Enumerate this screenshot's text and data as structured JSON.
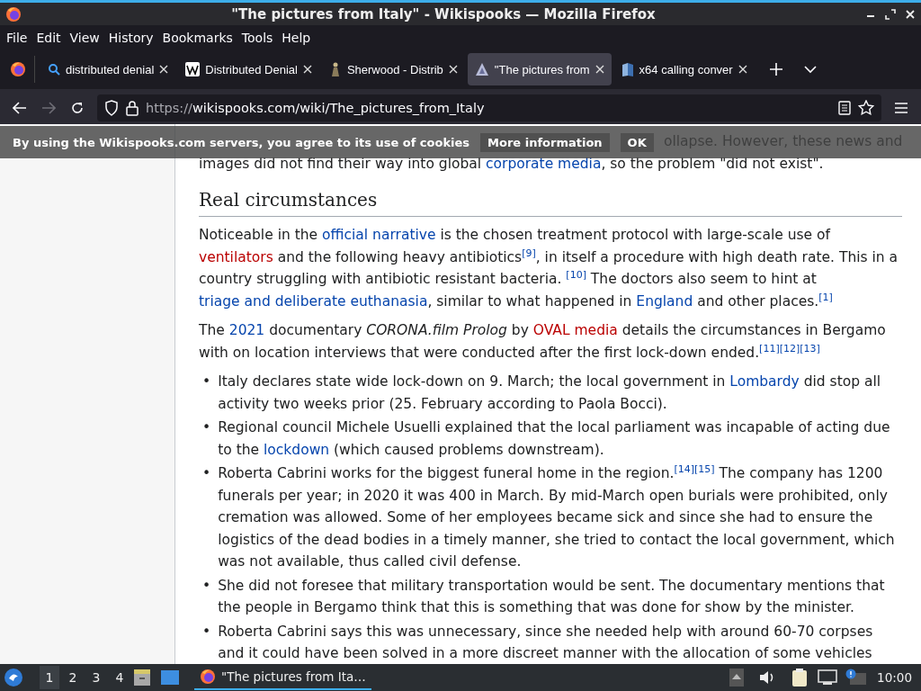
{
  "window": {
    "title": "\"The pictures from Italy\" - Wikispooks — Mozilla Firefox"
  },
  "menu": [
    "File",
    "Edit",
    "View",
    "History",
    "Bookmarks",
    "Tools",
    "Help"
  ],
  "tabs": [
    {
      "label": "distributed denial",
      "selected": false
    },
    {
      "label": "Distributed Denial",
      "selected": false
    },
    {
      "label": "Sherwood - Distrib",
      "selected": false
    },
    {
      "label": "\"The pictures from",
      "selected": true
    },
    {
      "label": "x64 calling conver",
      "selected": false
    }
  ],
  "url": {
    "scheme": "https://",
    "rest": "wikispooks.com/wiki/The_pictures_from_Italy"
  },
  "nav": {
    "forward_disabled": true
  },
  "cookie_banner": {
    "text": "By using the Wikispooks.com servers, you agree to its use of cookies",
    "buttons": [
      "More information",
      "OK"
    ]
  },
  "article": {
    "covered_line": "ollapse. However, these news and",
    "intro": [
      {
        "kind": "text",
        "text": "images did not find their way into global "
      },
      {
        "kind": "link",
        "text": "corporate media"
      },
      {
        "kind": "text",
        "text": ", so the problem \"did not exist\"."
      }
    ],
    "heading": "Real circumstances",
    "paragraphs": [
      [
        {
          "kind": "text",
          "text": "Noticeable in the "
        },
        {
          "kind": "link",
          "text": "official narrative"
        },
        {
          "kind": "text",
          "text": " is the chosen treatment protocol with large-scale use of "
        },
        {
          "kind": "redlink",
          "text": "ventilators"
        },
        {
          "kind": "text",
          "text": " and the following heavy antibiotics"
        },
        {
          "kind": "ref",
          "text": "[9]"
        },
        {
          "kind": "text",
          "text": ", in itself a procedure with high death rate. This in a country struggling with antibiotic resistant bacteria. "
        },
        {
          "kind": "ref",
          "text": "[10]"
        },
        {
          "kind": "text",
          "text": " The doctors also seem to hint at "
        },
        {
          "kind": "link",
          "text": "triage and deliberate euthanasia"
        },
        {
          "kind": "text",
          "text": ", similar to what happened in "
        },
        {
          "kind": "link",
          "text": "England"
        },
        {
          "kind": "text",
          "text": " and other places."
        },
        {
          "kind": "ref",
          "text": "[1]"
        }
      ],
      [
        {
          "kind": "text",
          "text": "The "
        },
        {
          "kind": "link",
          "text": "2021"
        },
        {
          "kind": "text",
          "text": " documentary "
        },
        {
          "kind": "italic",
          "text": "CORONA.film Prolog"
        },
        {
          "kind": "text",
          "text": " by "
        },
        {
          "kind": "redlink",
          "text": "OVAL media"
        },
        {
          "kind": "text",
          "text": " details the circumstances in Bergamo with on location interviews that were conducted after the first lock-down ended."
        },
        {
          "kind": "ref",
          "text": "[11]"
        },
        {
          "kind": "ref",
          "text": "[12]"
        },
        {
          "kind": "ref",
          "text": "[13]"
        }
      ]
    ],
    "bullets": [
      {
        "marker": "•",
        "segments": [
          {
            "kind": "text",
            "text": "Italy declares state wide lock-down on 9. March; the local government in "
          },
          {
            "kind": "link",
            "text": "Lombardy"
          },
          {
            "kind": "text",
            "text": " did stop all activity two weeks prior (25. February according to Paola Bocci)."
          }
        ]
      },
      {
        "marker": "•",
        "segments": [
          {
            "kind": "text",
            "text": "Regional council Michele Usuelli explained that the local parliament was incapable of acting due to the "
          },
          {
            "kind": "link",
            "text": "lockdown"
          },
          {
            "kind": "text",
            "text": " (which caused problems downstream)."
          }
        ]
      },
      {
        "marker": "•",
        "segments": [
          {
            "kind": "text",
            "text": "Roberta Cabrini works for the biggest funeral home in the region."
          },
          {
            "kind": "ref",
            "text": "[14]"
          },
          {
            "kind": "ref",
            "text": "[15]"
          },
          {
            "kind": "text",
            "text": " The company has 1200 funerals per year; in 2020 it was 400 in March. By mid-March open burials were prohibited, only cremation was allowed. Some of her employees became sick and since she had to ensure the logistics of the dead bodies in a timely manner, she tried to contact the local government, which was not available, thus called civil defense."
          }
        ]
      },
      {
        "marker": "•",
        "segments": [
          {
            "kind": "text",
            "text": "She did not foresee that military transportation would be sent. The documentary mentions that the people in Bergamo think that this is something that was done for show by the minister."
          }
        ]
      },
      {
        "marker": "•",
        "segments": [
          {
            "kind": "text",
            "text": "Roberta Cabrini says this was unnecessary, since she needed help with around 60-70 corpses and it could have been solved in a more discreet manner with the allocation of some vehicles"
          }
        ]
      }
    ]
  },
  "taskbar": {
    "workspaces": [
      {
        "label": "1",
        "selected": true
      },
      {
        "label": "2",
        "selected": false
      },
      {
        "label": "3",
        "selected": false
      },
      {
        "label": "4",
        "selected": false
      }
    ],
    "task": "\"The pictures from Ita…",
    "clock": "10:00"
  }
}
